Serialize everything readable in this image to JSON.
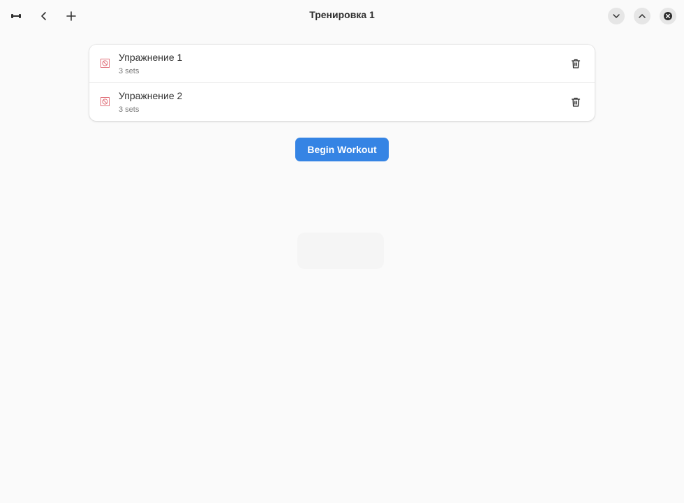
{
  "window": {
    "title": "Тренировка 1"
  },
  "headerbar": {
    "app_icon": "dumbbell-icon",
    "back_icon": "chevron-left-icon",
    "add_icon": "plus-icon",
    "scroll_down_icon": "chevron-down-icon",
    "scroll_up_icon": "chevron-up-icon",
    "close_icon": "close-icon"
  },
  "exercises": [
    {
      "name": "Упражнение 1",
      "sets": "3 sets",
      "icon": "missing-image-icon",
      "delete_icon": "trash-icon"
    },
    {
      "name": "Упражнение 2",
      "sets": "3 sets",
      "icon": "missing-image-icon",
      "delete_icon": "trash-icon"
    }
  ],
  "actions": {
    "begin_label": "Begin Workout"
  },
  "colors": {
    "accent": "#3584e4",
    "background": "#fafafa",
    "card": "#ffffff",
    "missing_icon": "#e0707a"
  }
}
